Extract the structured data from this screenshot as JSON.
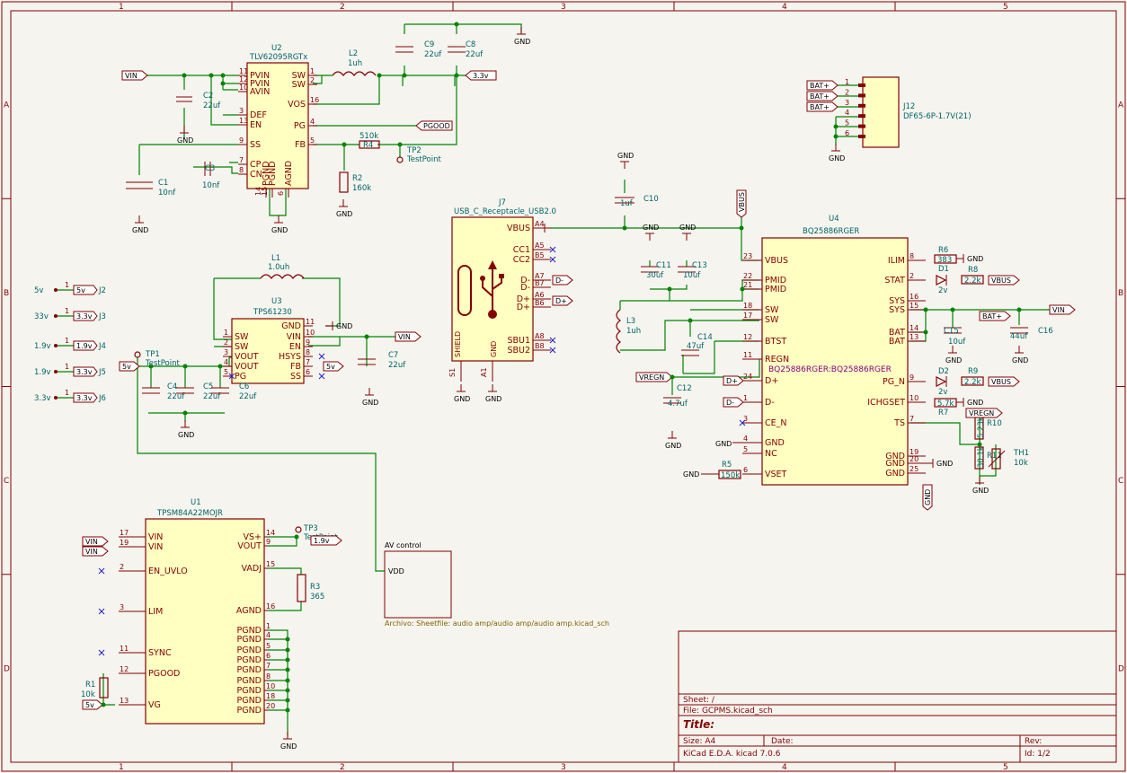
{
  "frame": {
    "columns": [
      "1",
      "2",
      "3",
      "4",
      "5"
    ],
    "rows": [
      "A",
      "B",
      "C",
      "D"
    ]
  },
  "title_block": {
    "sheet": "Sheet: /",
    "file": "File: GCPMS.kicad_sch",
    "title": "Title:",
    "size": "Size: A4",
    "date": "Date:",
    "rev": "Rev:",
    "tool": "KiCad E.D.A.  kicad 7.0.6",
    "id": "Id: 1/2"
  },
  "u2": {
    "ref": "U2",
    "value": "TLV62095RGTx",
    "pins_left": [
      {
        "n": "11",
        "name": "PVIN"
      },
      {
        "n": "12",
        "name": "PVIN"
      },
      {
        "n": "10",
        "name": "AVIN"
      },
      {
        "n": "3",
        "name": "DEF"
      },
      {
        "n": "13",
        "name": "EN"
      },
      {
        "n": "9",
        "name": "SS"
      },
      {
        "n": "7",
        "name": "CP"
      },
      {
        "n": "8",
        "name": "CN"
      }
    ],
    "pins_right": [
      {
        "n": "1",
        "name": "SW"
      },
      {
        "n": "2",
        "name": "SW"
      },
      {
        "n": "16",
        "name": "VOS"
      },
      {
        "n": "4",
        "name": "PG"
      },
      {
        "n": "5",
        "name": "FB"
      }
    ],
    "pins_bottom": [
      "PGND",
      "PGND",
      "AGND"
    ],
    "bottom_nums": [
      "14",
      "15",
      "6"
    ]
  },
  "u3": {
    "ref": "U3",
    "value": "TPS61230",
    "pins_left": [
      {
        "n": "1",
        "name": "SW"
      },
      {
        "n": "2",
        "name": "SW"
      },
      {
        "n": "3",
        "name": "VOUT"
      },
      {
        "n": "4",
        "name": "VOUT"
      },
      {
        "n": "5",
        "name": "PG"
      }
    ],
    "pins_right": [
      {
        "n": "11",
        "name": "GND"
      },
      {
        "n": "10",
        "name": "VIN"
      },
      {
        "n": "9",
        "name": "EN"
      },
      {
        "n": "8",
        "name": "HSYS"
      },
      {
        "n": "7",
        "name": "FB"
      },
      {
        "n": "6",
        "name": "SS"
      }
    ]
  },
  "u1": {
    "ref": "U1",
    "value": "TPSM84A22MOJR",
    "pins_left": [
      {
        "n": "17",
        "name": "VIN"
      },
      {
        "n": "19",
        "name": "VIN"
      },
      {
        "n": "2",
        "name": "EN_UVLO"
      },
      {
        "n": "3",
        "name": "LIM"
      },
      {
        "n": "11",
        "name": "SYNC"
      },
      {
        "n": "12",
        "name": "PGOOD"
      },
      {
        "n": "13",
        "name": "VG"
      }
    ],
    "pins_right": [
      {
        "n": "14",
        "name": "VS+"
      },
      {
        "n": "9",
        "name": "VOUT"
      },
      {
        "n": "15",
        "name": "VADJ"
      },
      {
        "n": "16",
        "name": "AGND"
      },
      {
        "n": "1",
        "name": "PGND"
      },
      {
        "n": "4",
        "name": "PGND"
      },
      {
        "n": "5",
        "name": "PGND"
      },
      {
        "n": "6",
        "name": "PGND"
      },
      {
        "n": "7",
        "name": "PGND"
      },
      {
        "n": "8",
        "name": "PGND"
      },
      {
        "n": "10",
        "name": "PGND"
      },
      {
        "n": "18",
        "name": "PGND"
      },
      {
        "n": "20",
        "name": "PGND"
      }
    ]
  },
  "u4": {
    "ref": "U4",
    "value": "BQ25886RGER",
    "unit": "BQ25886RGER:BQ25886RGER",
    "pins_left": [
      {
        "n": "23",
        "name": "VBUS"
      },
      {
        "n": "22",
        "name": "PMID"
      },
      {
        "n": "21",
        "name": "PMID"
      },
      {
        "n": "18",
        "name": "SW"
      },
      {
        "n": "17",
        "name": "SW"
      },
      {
        "n": "12",
        "name": "BTST"
      },
      {
        "n": "11",
        "name": "REGN"
      },
      {
        "n": "24",
        "name": "D+"
      },
      {
        "n": "1",
        "name": "D-"
      },
      {
        "n": "3",
        "name": "CE_N"
      },
      {
        "n": "4",
        "name": "GND"
      },
      {
        "n": "5",
        "name": "NC"
      },
      {
        "n": "6",
        "name": "VSET"
      }
    ],
    "pins_right": [
      {
        "n": "8",
        "name": "ILIM"
      },
      {
        "n": "2",
        "name": "STAT"
      },
      {
        "n": "16",
        "name": "SYS"
      },
      {
        "n": "15",
        "name": "SYS"
      },
      {
        "n": "14",
        "name": "BAT"
      },
      {
        "n": "13",
        "name": "BAT"
      },
      {
        "n": "9",
        "name": "PG_N"
      },
      {
        "n": "10",
        "name": "ICHGSET"
      },
      {
        "n": "7",
        "name": "TS"
      },
      {
        "n": "19",
        "name": "GND"
      },
      {
        "n": "20",
        "name": "GND"
      },
      {
        "n": "25",
        "name": "GND"
      }
    ]
  },
  "j7": {
    "ref": "J7",
    "value": "USB_C_Receptacle_USB2.0",
    "pins_right": [
      {
        "n": "A4",
        "name": "VBUS"
      },
      {
        "n": "A5",
        "name": "CC1"
      },
      {
        "n": "B5",
        "name": "CC2"
      },
      {
        "n": "A7",
        "name": "D-"
      },
      {
        "n": "B7",
        "name": "D-"
      },
      {
        "n": "A6",
        "name": "D+"
      },
      {
        "n": "B6",
        "name": "D+"
      },
      {
        "n": "A8",
        "name": "SBU1"
      },
      {
        "n": "B8",
        "name": "SBU2"
      }
    ],
    "shield": "SHIELD",
    "gnd": "GND",
    "s1": "S1",
    "a1": "A1"
  },
  "j12": {
    "ref": "J12",
    "value": "DF65-6P-1.7V(21)",
    "pins": [
      "1",
      "2",
      "3",
      "4",
      "5",
      "6"
    ],
    "labels": [
      "BAT+",
      "BAT+",
      "BAT+"
    ]
  },
  "passives": [
    {
      "ref": "C2",
      "val": "22uf"
    },
    {
      "ref": "C1",
      "val": "10nf"
    },
    {
      "ref": "C3",
      "val": "10nf"
    },
    {
      "ref": "C9",
      "val": "22uf"
    },
    {
      "ref": "C8",
      "val": "22uf"
    },
    {
      "ref": "L2",
      "val": "1uh"
    },
    {
      "ref": "R4",
      "val": "510k"
    },
    {
      "ref": "R2",
      "val": "160k"
    },
    {
      "ref": "TP2",
      "val": "TestPoint"
    },
    {
      "ref": "L1",
      "val": "1.0uh"
    },
    {
      "ref": "C4",
      "val": "22uf"
    },
    {
      "ref": "C5",
      "val": "22uf"
    },
    {
      "ref": "C6",
      "val": "22uf"
    },
    {
      "ref": "C7",
      "val": "22uf"
    },
    {
      "ref": "TP1",
      "val": "TestPoint"
    },
    {
      "ref": "TP3",
      "val": "TestPoint"
    },
    {
      "ref": "R3",
      "val": "365"
    },
    {
      "ref": "R1",
      "val": "10k"
    },
    {
      "ref": "C10",
      "val": "1uf"
    },
    {
      "ref": "C11",
      "val": "30uf"
    },
    {
      "ref": "C13",
      "val": "10uf"
    },
    {
      "ref": "L3",
      "val": "1uh"
    },
    {
      "ref": "C14",
      "val": "47uf"
    },
    {
      "ref": "C12",
      "val": "4.7uf"
    },
    {
      "ref": "R5",
      "val": "150k"
    },
    {
      "ref": "R6",
      "val": "383"
    },
    {
      "ref": "D1",
      "val": "2v"
    },
    {
      "ref": "R8",
      "val": "2.2k"
    },
    {
      "ref": "C15",
      "val": "10uf"
    },
    {
      "ref": "C16",
      "val": "44uf"
    },
    {
      "ref": "D2",
      "val": "2v"
    },
    {
      "ref": "R9",
      "val": "2.2k"
    },
    {
      "ref": "R7",
      "val": "5.7k"
    },
    {
      "ref": "R10",
      "val": "5.23k"
    },
    {
      "ref": "R11",
      "val": "30.1k"
    },
    {
      "ref": "TH1",
      "val": "10k"
    }
  ],
  "jumpers": [
    {
      "net": "5v",
      "ref": "J2",
      "pin": "1"
    },
    {
      "net": "33v",
      "ref": "J3",
      "pin": "1",
      "flag": "3.3v"
    },
    {
      "net": "1.9v",
      "ref": "J4",
      "pin": "1",
      "flag": "1.9v"
    },
    {
      "net": "1.9v",
      "ref": "J5",
      "pin": "1",
      "flag": "3.3v"
    },
    {
      "net": "3.3v",
      "ref": "J6",
      "pin": "1",
      "flag": "3.3v"
    }
  ],
  "nets": {
    "vin": "VIN",
    "v33": "3.3v",
    "pgood": "PGOOD",
    "v5": "5v",
    "v19": "1.9v",
    "vbus": "VBUS",
    "regn": "VREGN",
    "dminus": "D-",
    "dplus": "D+",
    "batp": "BAT+",
    "gnd": "GND"
  },
  "sheet_av": {
    "name": "AV control",
    "pin": "VDD",
    "file": "Archivo: Sheetfile: audio amp/audio amp/audio amp.kicad_sch"
  }
}
